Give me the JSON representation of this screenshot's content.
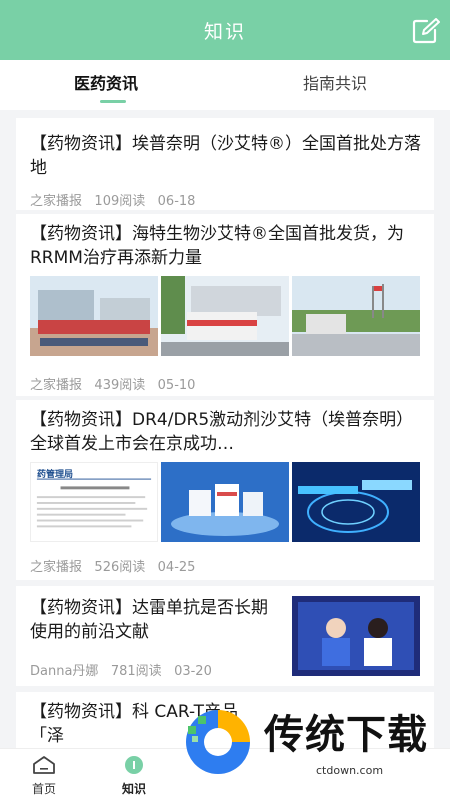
{
  "header": {
    "title": "知识",
    "edit_icon": "edit-icon"
  },
  "tabs": [
    {
      "label": "医药资讯",
      "active": true
    },
    {
      "label": "指南共识",
      "active": false
    }
  ],
  "articles": [
    {
      "title": "【药物资讯】埃普奈明（沙艾特®）全国首批处方落地",
      "author": "之家播报",
      "reads": "109阅读",
      "date": "06-18"
    },
    {
      "title": "【药物资讯】海特生物沙艾特®全国首批发货，为RRMM治疗再添新力量",
      "author": "之家播报",
      "reads": "439阅读",
      "date": "05-10"
    },
    {
      "title": "【药物资讯】DR4/DR5激动剂沙艾特（埃普奈明）全球首发上市会在京成功…",
      "author": "之家播报",
      "reads": "526阅读",
      "date": "04-25",
      "image_caption": "药管理局"
    },
    {
      "title": "【药物资讯】达雷单抗是否长期使用的前沿文献",
      "author": "Danna丹娜",
      "reads": "781阅读",
      "date": "03-20"
    },
    {
      "title": "【药物资讯】科 CAR-T产品「泽"
    }
  ],
  "bottom_nav": [
    {
      "label": "首页",
      "icon": "home-icon"
    },
    {
      "label": "知识",
      "icon": "knowledge-icon",
      "active": true
    }
  ],
  "watermark": {
    "title": "传统下载",
    "url": "ctdown.com"
  },
  "colors": {
    "primary": "#79d0a6",
    "background": "#f3f4f6"
  }
}
